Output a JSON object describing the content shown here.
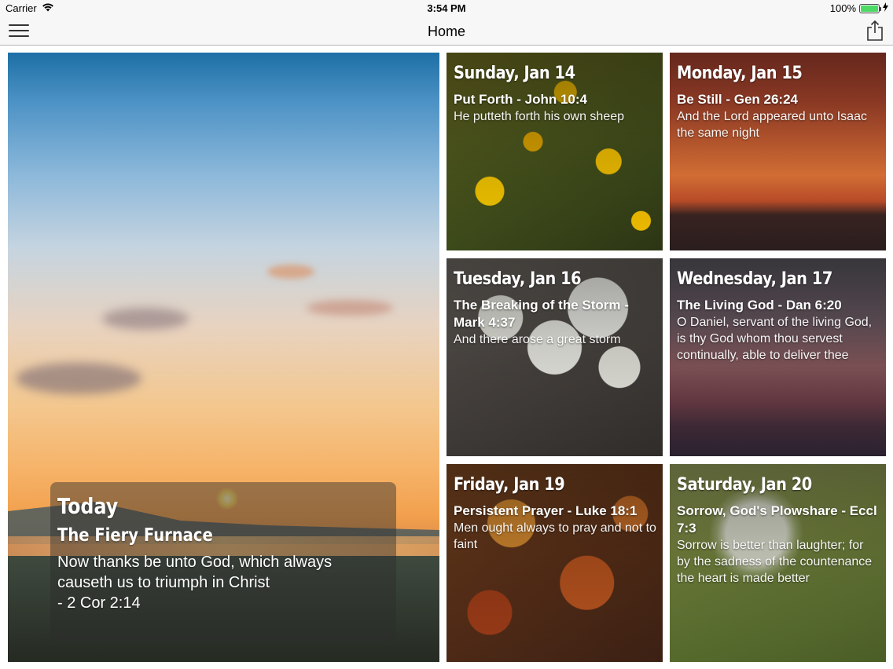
{
  "status_bar": {
    "carrier": "Carrier",
    "time": "3:54 PM",
    "battery_percent": "100%",
    "battery_level": 1.0,
    "icons": [
      "wifi-icon",
      "battery-icon",
      "charging-bolt-icon"
    ]
  },
  "nav": {
    "title": "Home",
    "left_icon": "hamburger-menu-icon",
    "right_icon": "share-icon"
  },
  "featured": {
    "label": "Today",
    "title": "The Fiery Furnace",
    "verse_line1": "Now thanks be unto God, which always",
    "verse_line2": "causeth us to triumph in Christ",
    "reference": "- 2 Cor 2:14"
  },
  "tiles": [
    {
      "date": "Sunday, Jan 14",
      "title": "Put Forth - John 10:4",
      "verse": "He putteth forth his own sheep"
    },
    {
      "date": "Monday, Jan 15",
      "title": "Be Still - Gen 26:24",
      "verse": "And the Lord appeared unto Isaac the same night"
    },
    {
      "date": "Tuesday, Jan 16",
      "title": "The Breaking of the Storm - Mark 4:37",
      "verse": "And there arose a great storm"
    },
    {
      "date": "Wednesday, Jan 17",
      "title": "The Living God - Dan 6:20",
      "verse": "O Daniel, servant of the living God, is thy God whom thou servest continually, able to deliver thee"
    },
    {
      "date": "Friday, Jan 19",
      "title": "Persistent Prayer - Luke 18:1",
      "verse": "Men ought always to pray and not to faint"
    },
    {
      "date": "Saturday, Jan 20",
      "title": "Sorrow, God's Plowshare - Eccl 7:3",
      "verse": "Sorrow is better than laughter; for by the sadness of the countenance the heart is made better"
    }
  ]
}
